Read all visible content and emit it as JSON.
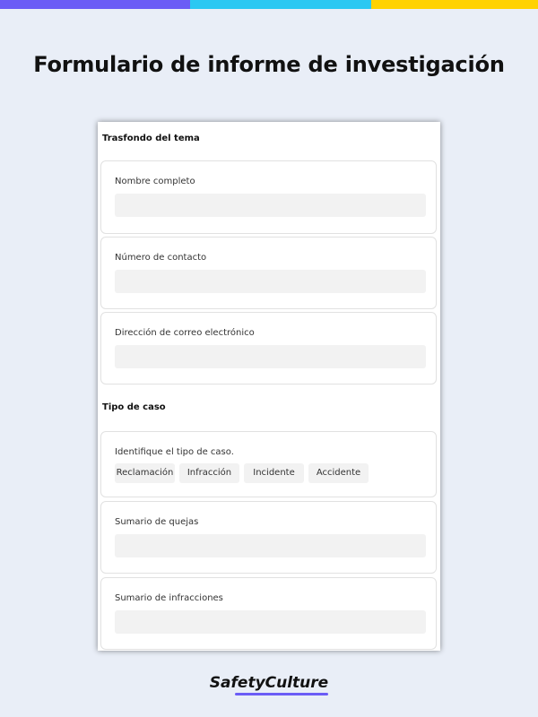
{
  "colors": {
    "background": "#e9eef7",
    "bar_purple": "#6b5cf6",
    "bar_cyan": "#2bc8f2",
    "bar_yellow": "#ffd200",
    "logo_underline": "#6b5cf6"
  },
  "page": {
    "title": "Formulario de informe de investigación"
  },
  "form": {
    "sections": [
      {
        "heading": "Trasfondo del tema",
        "fields": [
          {
            "label": "Nombre completo",
            "value": ""
          },
          {
            "label": "Número de contacto",
            "value": ""
          },
          {
            "label": "Dirección de correo electrónico",
            "value": ""
          }
        ]
      },
      {
        "heading": "Tipo de caso",
        "question": {
          "label": "Identifique el tipo de caso.",
          "options": [
            "Reclamación",
            "Infracción",
            "Incidente",
            "Accidente"
          ]
        },
        "fields": [
          {
            "label": "Sumario de quejas",
            "value": ""
          },
          {
            "label": "Sumario de infracciones",
            "value": ""
          }
        ]
      }
    ]
  },
  "brand": {
    "logo_text": "SafetyCulture"
  }
}
